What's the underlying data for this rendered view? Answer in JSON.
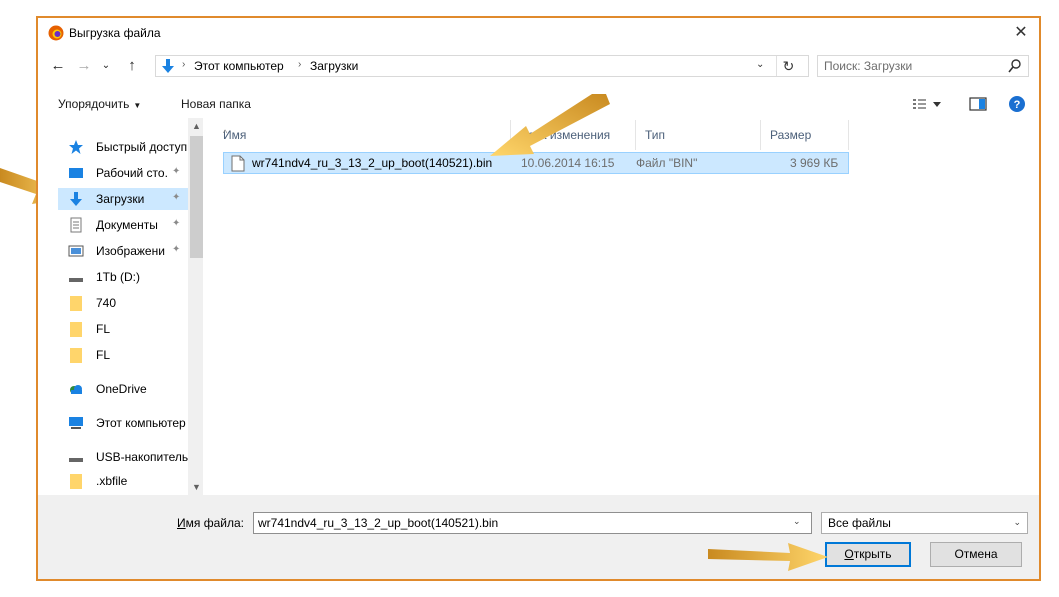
{
  "window": {
    "title": "Выгрузка файла"
  },
  "nav": {
    "breadcrumb": [
      "Этот компьютер",
      "Загрузки"
    ],
    "search_placeholder": "Поиск: Загрузки"
  },
  "commands": {
    "organize": "Упорядочить",
    "new_folder": "Новая папка"
  },
  "sidebar": {
    "items": [
      {
        "label": "Быстрый доступ",
        "icon": "star-icon"
      },
      {
        "label": "Рабочий сто.",
        "icon": "desktop-icon",
        "pinned": true
      },
      {
        "label": "Загрузки",
        "icon": "download-arrow-icon",
        "pinned": true,
        "selected": true
      },
      {
        "label": "Документы",
        "icon": "documents-icon",
        "pinned": true
      },
      {
        "label": "Изображени",
        "icon": "pictures-icon",
        "pinned": true
      },
      {
        "label": "1Tb (D:)",
        "icon": "drive-icon"
      },
      {
        "label": "740",
        "icon": "folder-icon"
      },
      {
        "label": "FL",
        "icon": "folder-icon"
      },
      {
        "label": "FL",
        "icon": "folder-icon"
      },
      {
        "label": "OneDrive",
        "icon": "onedrive-icon"
      },
      {
        "label": "Этот компьютер",
        "icon": "computer-icon"
      },
      {
        "label": "USB-накопитель",
        "icon": "usb-drive-icon"
      },
      {
        "label": ".xbfile",
        "icon": "folder-icon"
      }
    ]
  },
  "table": {
    "columns": [
      "Имя",
      "Дата изменения",
      "Тип",
      "Размер"
    ],
    "rows": [
      {
        "name": "wr741ndv4_ru_3_13_2_up_boot(140521).bin",
        "date": "10.06.2014 16:15",
        "type": "Файл \"BIN\"",
        "size": "3 969 КБ"
      }
    ]
  },
  "footer": {
    "filename_label_u": "И",
    "filename_label_rest": "мя файла:",
    "filename_value": "wr741ndv4_ru_3_13_2_up_boot(140521).bin",
    "filter": "Все файлы",
    "open_u": "О",
    "open_rest": "ткрыть",
    "cancel": "Отмена"
  },
  "colors": {
    "accent": "#0078d7",
    "highlight": "#cce8ff",
    "frame": "#e08a2c",
    "arrow": "#f2b335"
  }
}
